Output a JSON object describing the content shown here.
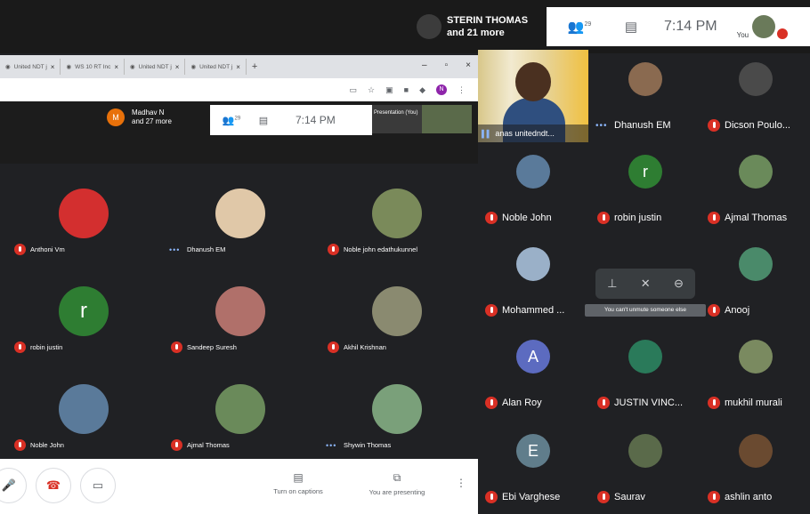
{
  "top_bar": {
    "presenter_name": "STERIN THOMAS",
    "presenter_more": "and 21 more",
    "people_count": "29",
    "time": "7:14 PM",
    "you_label": "You"
  },
  "browser": {
    "tabs": [
      {
        "label": "United NDT j"
      },
      {
        "label": "WS 10 RT Inc"
      },
      {
        "label": "United NDT j"
      },
      {
        "label": "United NDT j"
      }
    ],
    "tab_close": "×",
    "new_tab": "+",
    "window_controls": [
      "–",
      "▫",
      "×"
    ],
    "profile_initial": "N"
  },
  "inner_meet": {
    "presenter_initial": "M",
    "presenter_name": "Madhav N",
    "presenter_more": "and 27 more",
    "people_count": "29",
    "time": "7:14 PM",
    "thumb_label": "Presentation (You)",
    "participants": [
      {
        "name": "Anthoni Vm",
        "status": "muted",
        "avatar_color": "#d32f2f"
      },
      {
        "name": "Dhanush EM",
        "status": "speaking",
        "avatar_color": "#e0c8a8"
      },
      {
        "name": "Noble john edathukunnel",
        "status": "muted",
        "avatar_color": "#7a8a5a"
      },
      {
        "name": "robin justin",
        "status": "muted",
        "avatar_color": "#2e7d32",
        "initial": "r"
      },
      {
        "name": "Sandeep Suresh",
        "status": "muted",
        "avatar_color": "#b0706a"
      },
      {
        "name": "Akhil Krishnan",
        "status": "muted",
        "avatar_color": "#8a8a70"
      },
      {
        "name": "Noble John",
        "status": "muted",
        "avatar_color": "#5a7a9a"
      },
      {
        "name": "Ajmal Thomas",
        "status": "muted",
        "avatar_color": "#6a8a5a"
      },
      {
        "name": "Shywin Thomas",
        "status": "speaking",
        "avatar_color": "#7aa07a"
      }
    ],
    "bottom": {
      "captions_label": "Turn on captions",
      "presenting_label": "You are presenting",
      "more": "⋮"
    }
  },
  "presenter_video": {
    "name": "anas unitedndt..."
  },
  "right_grid": {
    "participants": [
      {
        "name": "Dhanush EM",
        "status": "speaking",
        "avatar_color": "#8a6a50"
      },
      {
        "name": "Dicson Poulo...",
        "status": "muted",
        "avatar_color": "#4a4a4a"
      },
      {
        "name": "Noble John",
        "status": "muted",
        "avatar_color": "#5a7a9a"
      },
      {
        "name": "robin justin",
        "status": "muted",
        "avatar_color": "#2e7d32",
        "initial": "r"
      },
      {
        "name": "Ajmal Thomas",
        "status": "muted",
        "avatar_color": "#6a8a5a"
      },
      {
        "name": "Mohammed ...",
        "status": "muted",
        "avatar_color": "#9ab0c8"
      },
      {
        "name": "Anooj",
        "status": "muted",
        "avatar_color": "#4a8a6a"
      },
      {
        "name": "Alan Roy",
        "status": "muted",
        "avatar_color": "#5c6bc0",
        "initial": "A"
      },
      {
        "name": "JUSTIN VINC...",
        "status": "muted",
        "avatar_color": "#2a7a5a"
      },
      {
        "name": "mukhil murali",
        "status": "muted",
        "avatar_color": "#7a8a60"
      },
      {
        "name": "Ebi Varghese",
        "status": "muted",
        "avatar_color": "#607d8b",
        "initial": "E"
      },
      {
        "name": "Saurav",
        "status": "muted",
        "avatar_color": "#5a6a4a"
      },
      {
        "name": "ashlin anto",
        "status": "muted",
        "avatar_color": "#6a4a30"
      }
    ],
    "tooltip": "You can't unmute someone else"
  }
}
